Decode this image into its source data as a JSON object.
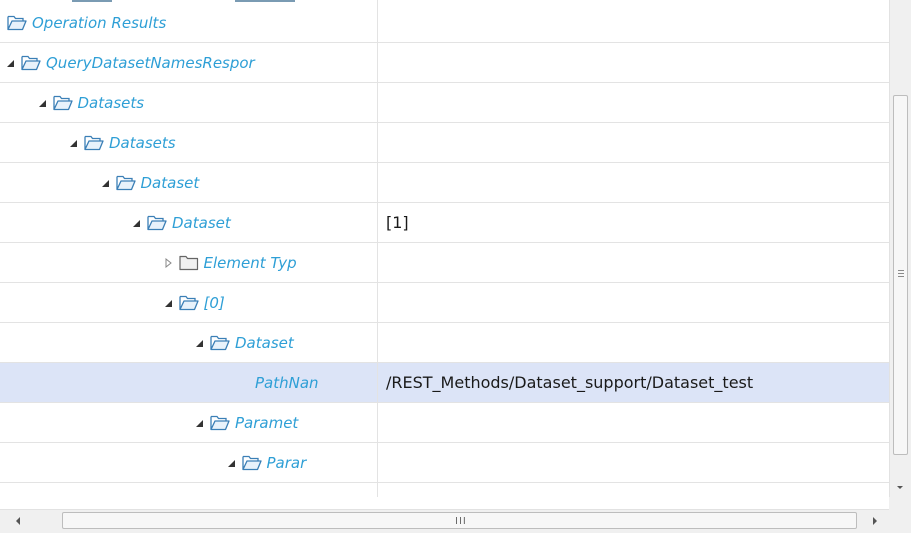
{
  "tree": {
    "rows": [
      {
        "label": "Operation Results",
        "value": "",
        "level": 0,
        "expander": "none",
        "folder": "open"
      },
      {
        "label": "QueryDatasetNamesRespor",
        "value": "",
        "level": 1,
        "expander": "expanded",
        "folder": "open"
      },
      {
        "label": "Datasets",
        "value": "",
        "level": 2,
        "expander": "expanded",
        "folder": "open"
      },
      {
        "label": "Datasets",
        "value": "",
        "level": 3,
        "expander": "expanded",
        "folder": "open"
      },
      {
        "label": "Dataset",
        "value": "",
        "level": 4,
        "expander": "expanded",
        "folder": "open"
      },
      {
        "label": "Dataset",
        "value": "[1]",
        "level": 5,
        "expander": "expanded",
        "folder": "open"
      },
      {
        "label": "Element Typ",
        "value": "",
        "level": 6,
        "expander": "collapsed",
        "folder": "closed"
      },
      {
        "label": "[0]",
        "value": "",
        "level": 6,
        "expander": "expanded",
        "folder": "open"
      },
      {
        "label": "Dataset",
        "value": "",
        "level": 7,
        "expander": "expanded",
        "folder": "open"
      },
      {
        "label": "PathNan",
        "value": "/REST_Methods/Dataset_support/Dataset_test",
        "level": 9,
        "expander": "none",
        "folder": "none",
        "selected": true
      },
      {
        "label": "Paramet",
        "value": "",
        "level": 7,
        "expander": "expanded",
        "folder": "open"
      },
      {
        "label": "Parar",
        "value": "",
        "level": 8,
        "expander": "expanded",
        "folder": "open"
      }
    ]
  },
  "scrollbars": {
    "horizontal_grip": "III"
  },
  "colors": {
    "label": "#2e9fd6",
    "selected_row": "#dce4f7",
    "folder_stroke": "#3b7fb6",
    "folder_fill_open": "#e8f2fb",
    "folder_fill_closed": "#f0f0f0"
  }
}
